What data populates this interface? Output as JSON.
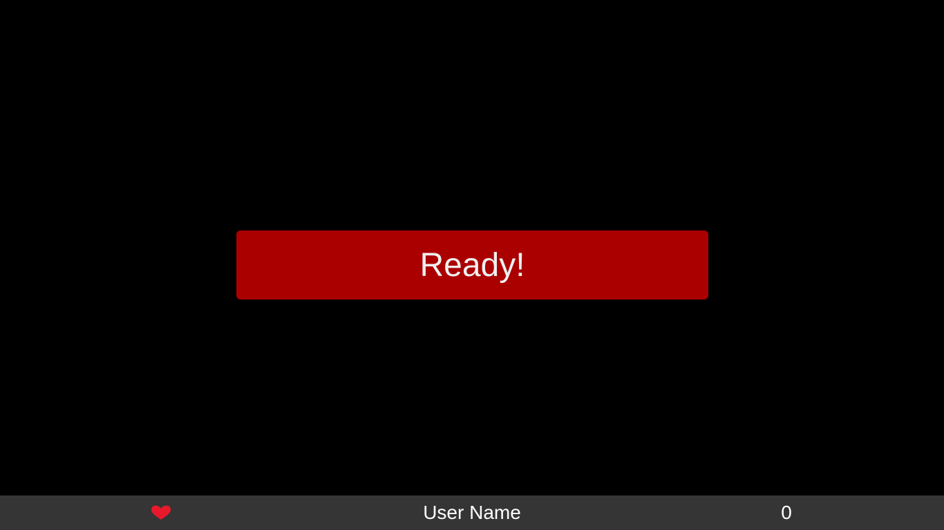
{
  "game": {
    "ready_label": "Ready!"
  },
  "status_bar": {
    "lives_icon": "heart-icon",
    "lives_color": "#e8192c",
    "user_name": "User Name",
    "score": "0"
  },
  "colors": {
    "background": "#000000",
    "button": "#aa0000",
    "button_text": "#f0f0f0",
    "status_bar": "#353535",
    "status_text": "#ffffff"
  }
}
